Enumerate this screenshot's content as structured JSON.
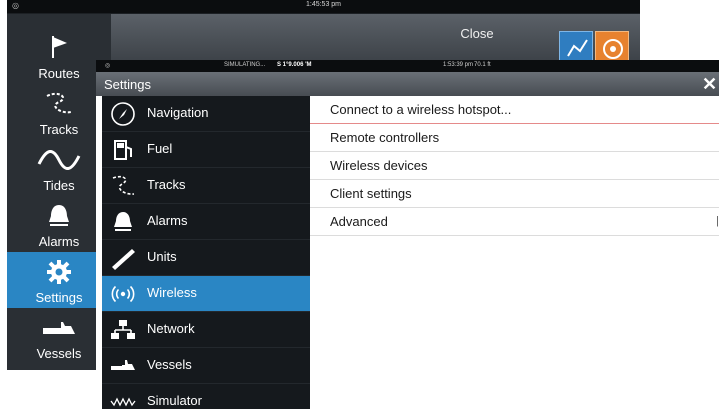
{
  "back_screen": {
    "clock": "1:45:53 pm",
    "close_label": "Close",
    "sidebar": [
      {
        "label": "Routes",
        "icon": "routes-icon"
      },
      {
        "label": "Tracks",
        "icon": "tracks-icon"
      },
      {
        "label": "Tides",
        "icon": "tides-icon"
      },
      {
        "label": "Alarms",
        "icon": "bell-icon"
      },
      {
        "label": "Settings",
        "icon": "gear-icon",
        "active": true
      },
      {
        "label": "Vessels",
        "icon": "vessels-icon"
      }
    ]
  },
  "dialog": {
    "status": {
      "simulating": "SIMULATING...",
      "boat": "S 1°9.006 'M",
      "time": "1:53:39 pm",
      "depth": "70.1 ft"
    },
    "title": "Settings",
    "close_glyph": "✕",
    "categories": [
      {
        "label": "Navigation",
        "icon": "compass-icon"
      },
      {
        "label": "Fuel",
        "icon": "fuel-icon"
      },
      {
        "label": "Tracks",
        "icon": "tracks-icon"
      },
      {
        "label": "Alarms",
        "icon": "bell-icon"
      },
      {
        "label": "Units",
        "icon": "ruler-icon"
      },
      {
        "label": "Wireless",
        "icon": "wireless-icon",
        "active": true
      },
      {
        "label": "Network",
        "icon": "network-icon"
      },
      {
        "label": "Vessels",
        "icon": "vessels-icon"
      },
      {
        "label": "Simulator",
        "icon": "simulator-icon"
      }
    ],
    "options": [
      {
        "label": "Connect to a wireless hotspot..."
      },
      {
        "label": "Remote controllers"
      },
      {
        "label": "Wireless devices"
      },
      {
        "label": "Client settings"
      },
      {
        "label": "Advanced"
      }
    ]
  },
  "colors": {
    "accent": "#2a86c4",
    "dark_panel": "#15191d",
    "title_bar": "#5b6168"
  }
}
